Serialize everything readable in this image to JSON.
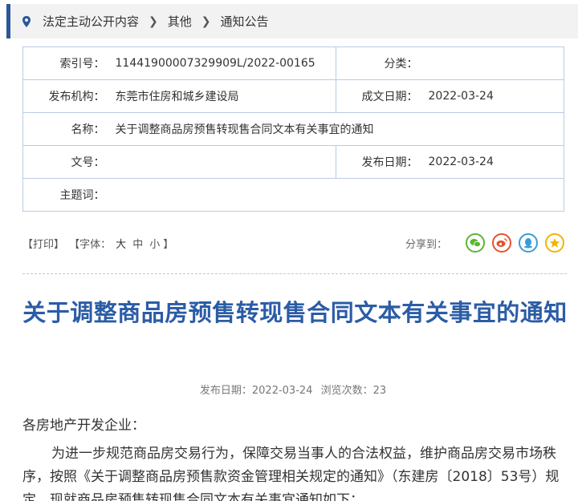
{
  "breadcrumb": {
    "items": [
      "法定主动公开内容",
      "其他",
      "通知公告"
    ]
  },
  "info": {
    "index_label": "索引号：",
    "index_value": "11441900007329909L/2022-00165",
    "category_label": "分类：",
    "category_value": "",
    "org_label": "发布机构：",
    "org_value": "东莞市住房和城乡建设局",
    "created_label": "成文日期：",
    "created_value": "2022-03-24",
    "name_label": "名称：",
    "name_value": "关于调整商品房预售转现售合同文本有关事宜的通知",
    "docno_label": "文号：",
    "docno_value": "",
    "published_label": "发布日期：",
    "published_value": "2022-03-24",
    "subject_label": "主题词：",
    "subject_value": ""
  },
  "tools": {
    "print": "【打印】",
    "font_prefix": "【字体：",
    "font_large": "大",
    "font_medium": "中",
    "font_small": "小",
    "font_suffix": "】",
    "share_label": "分享到："
  },
  "share_icons": [
    {
      "name": "wechat-icon",
      "color": "#5cb531"
    },
    {
      "name": "weibo-icon",
      "color": "#e6522c"
    },
    {
      "name": "qq-icon",
      "color": "#3a9bd9"
    },
    {
      "name": "qzone-icon",
      "color": "#f0b400"
    }
  ],
  "article": {
    "title": "关于调整商品房预售转现售合同文本有关事宜的通知",
    "meta_date": "发布日期：2022-03-24",
    "meta_views": "浏览次数：23",
    "salutation": "各房地产开发企业：",
    "paragraph1": "为进一步规范商品房交易行为，保障交易当事人的合法权益，维护商品房交易市场秩序，按照《关于调整商品房预售款资金管理相关规定的通知》（东建房〔2018〕53号）规定，现就商品房预售转现售合同文本有关事宜通知如下："
  },
  "colors": {
    "accent": "#2b579a",
    "title": "#2b5ca6",
    "table_border": "#b8cce4"
  }
}
